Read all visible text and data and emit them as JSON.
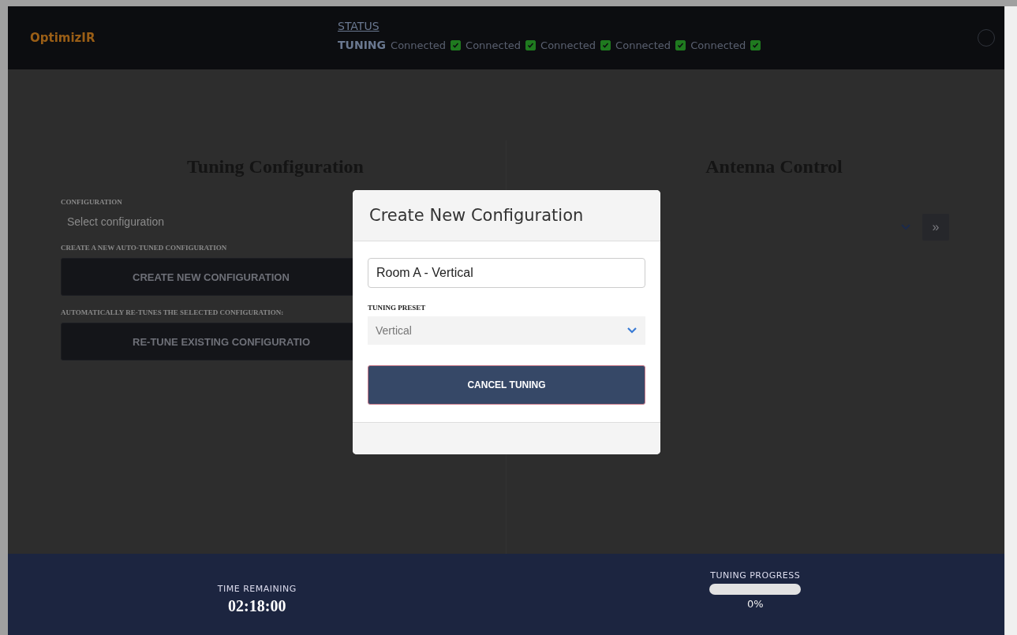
{
  "header": {
    "logo": "OptimizIR",
    "status_link": "STATUS",
    "tuning_label": "TUNING",
    "connections": [
      {
        "label": "Connected",
        "checked": true
      },
      {
        "label": "Connected",
        "checked": true
      },
      {
        "label": "Connected",
        "checked": true
      },
      {
        "label": "Connected",
        "checked": true
      },
      {
        "label": "Connected",
        "checked": true
      }
    ]
  },
  "tuning_configuration": {
    "title": "Tuning Configuration",
    "configuration_label": "CONFIGURATION",
    "configuration_placeholder": "Select configuration",
    "create_label": "CREATE A NEW AUTO-TUNED CONFIGURATION",
    "create_button": "CREATE NEW CONFIGURATION",
    "retune_label": "AUTOMATICALLY RE-TUNES THE SELECTED CONFIGURATION:",
    "retune_button": "RE-TUNE EXISTING CONFIGURATIO"
  },
  "antenna_control": {
    "title": "Antenna Control",
    "go_button": "»"
  },
  "dialog": {
    "title": "Create New Configuration",
    "name_value": "Room A - Vertical",
    "preset_label": "TUNING PRESET",
    "preset_value": "Vertical",
    "cancel_button": "CANCEL TUNING"
  },
  "footer": {
    "time_label": "TIME REMAINING",
    "time_value": "02:18:00",
    "progress_label": "TUNING PROGRESS",
    "progress": {
      "level": 0
    },
    "progress_text": "0%"
  }
}
